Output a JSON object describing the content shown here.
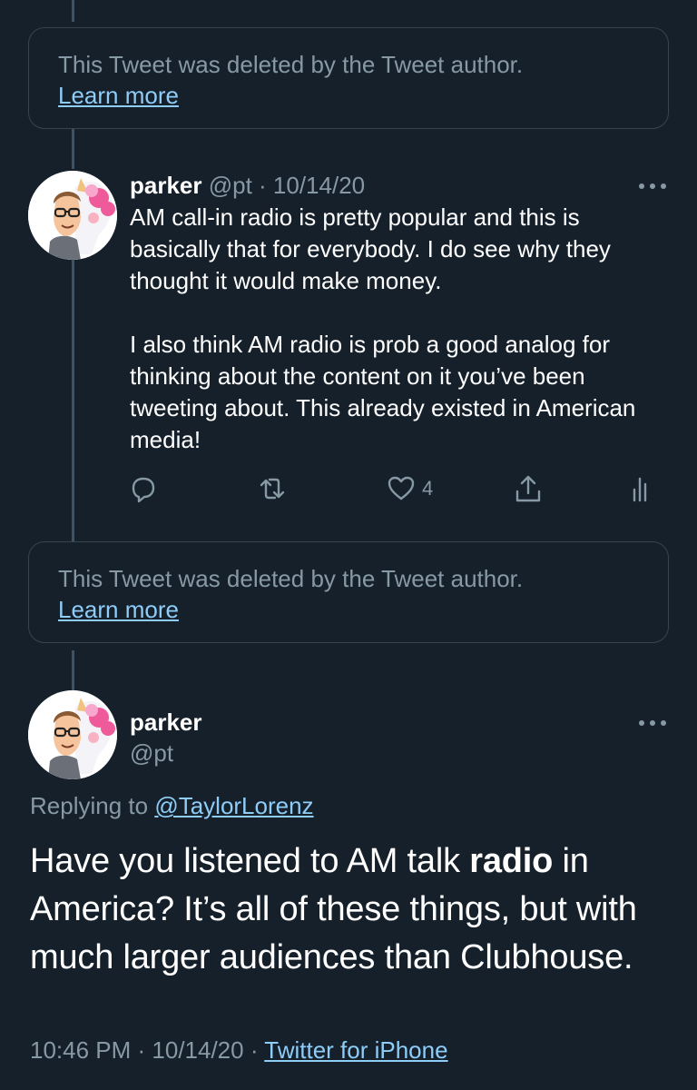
{
  "deleted_notice": {
    "text": "This Tweet was deleted by the Tweet author.",
    "link": "Learn more"
  },
  "reply_tweet": {
    "name": "parker",
    "handle_date": "@pt · 10/14/20",
    "avatar_icon": "bitmoji-avatar-with-unicorn",
    "paragraph1": "AM call-in radio is pretty popular and this is basically that for everybody. I do see why they thought it would make money.",
    "paragraph2": "I also think AM radio is prob a good analog for thinking about the content on it you’ve been tweeting about. This already existed in American media!",
    "actions": {
      "reply_icon": "reply-icon",
      "retweet_icon": "retweet-icon",
      "like_icon": "heart-icon",
      "like_count": "4",
      "share_icon": "share-icon",
      "analytics_icon": "analytics-icon"
    }
  },
  "main_tweet": {
    "name": "parker",
    "handle": "@pt",
    "replying_prefix": "Replying to ",
    "replying_to": "@TaylorLorenz",
    "text_before": "Have you listened to AM talk ",
    "text_bold": "radio",
    "text_after": " in America? It’s all of these things, but with much larger audiences than Clubhouse.",
    "timestamp": "10:46 PM · 10/14/20 · ",
    "source": "Twitter for iPhone"
  },
  "colors": {
    "background": "#15202b",
    "secondary_text": "#8899a6",
    "link": "#8ecdf8",
    "border": "#38444d",
    "thread_line": "#3d5466"
  }
}
